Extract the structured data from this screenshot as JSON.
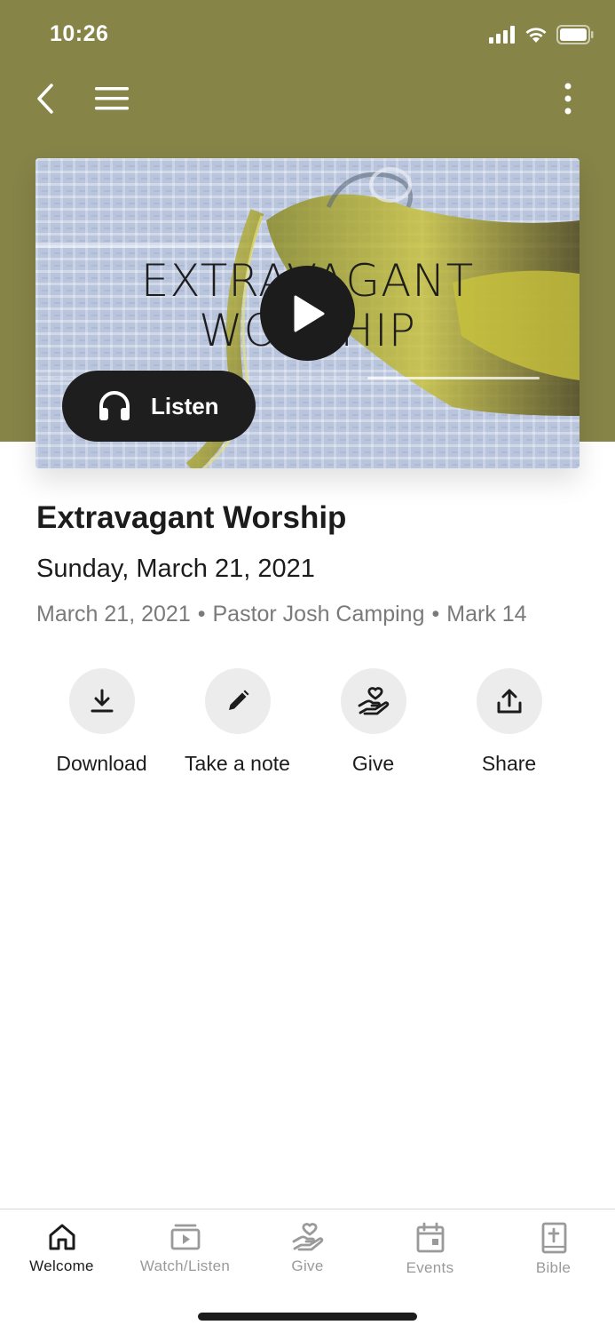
{
  "status_bar": {
    "time": "10:26"
  },
  "colors": {
    "header": "#868447",
    "accent_dark": "#1e1e1e",
    "action_bg": "#ececec",
    "tab_inactive": "#9a9a9a"
  },
  "media": {
    "series_title_line1": "EXTRAVAGANT",
    "series_title_line2": "WORSHIP",
    "listen_label": "Listen",
    "play_icon": "play-icon",
    "listen_icon": "headphones-icon"
  },
  "sermon": {
    "title": "Extravagant Worship",
    "date": "Sunday, March 21, 2021",
    "meta_date": "March 21, 2021",
    "speaker": "Pastor Josh Camping",
    "scripture": "Mark 14",
    "separator": "•"
  },
  "actions": [
    {
      "label": "Download",
      "icon": "download-icon"
    },
    {
      "label": "Take a note",
      "icon": "pencil-icon"
    },
    {
      "label": "Give",
      "icon": "hand-heart-icon"
    },
    {
      "label": "Share",
      "icon": "share-icon"
    }
  ],
  "tabs": [
    {
      "label": "Welcome",
      "icon": "home-icon",
      "active": true
    },
    {
      "label": "Watch/Listen",
      "icon": "video-icon",
      "active": false
    },
    {
      "label": "Give",
      "icon": "hand-heart-icon",
      "active": false
    },
    {
      "label": "Events",
      "icon": "calendar-icon",
      "active": false
    },
    {
      "label": "Bible",
      "icon": "bible-icon",
      "active": false
    }
  ]
}
